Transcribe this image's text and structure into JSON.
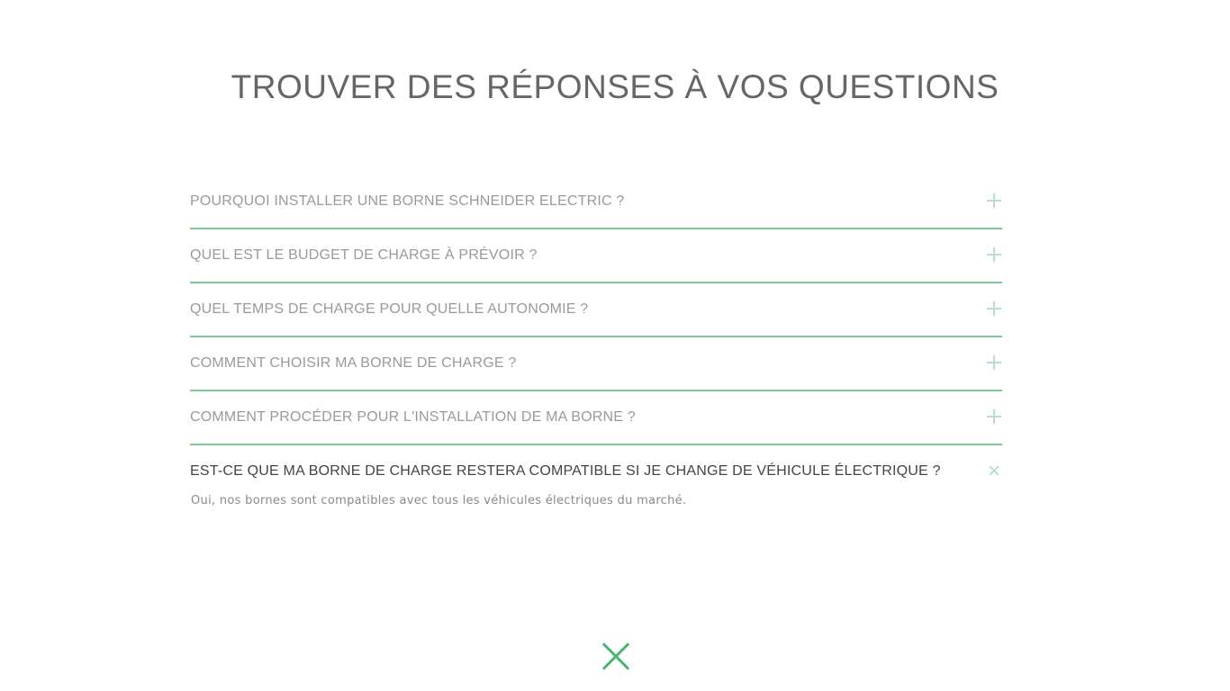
{
  "page": {
    "title": "TROUVER DES RÉPONSES À VOS QUESTIONS"
  },
  "faq": {
    "items": [
      {
        "question": "POURQUOI INSTALLER UNE BORNE SCHNEIDER ELECTRIC ?",
        "state": "collapsed",
        "icon": "plus-icon"
      },
      {
        "question": "QUEL EST LE BUDGET DE CHARGE À PRÉVOIR ?",
        "state": "collapsed",
        "icon": "plus-icon"
      },
      {
        "question": "QUEL TEMPS DE CHARGE POUR QUELLE AUTONOMIE ?",
        "state": "collapsed",
        "icon": "plus-icon"
      },
      {
        "question": "COMMENT CHOISIR MA BORNE DE CHARGE ?",
        "state": "collapsed",
        "icon": "plus-icon"
      },
      {
        "question": "COMMENT PROCÉDER POUR L'INSTALLATION DE MA BORNE ?",
        "state": "collapsed",
        "icon": "plus-icon"
      },
      {
        "question": "EST-CE QUE MA BORNE DE CHARGE RESTERA COMPATIBLE SI JE CHANGE DE VÉHICULE ÉLECTRIQUE ?",
        "state": "expanded",
        "icon": "x-icon",
        "answer": "Oui, nos bornes sont compatibles avec tous les véhicules électriques du marché."
      }
    ]
  },
  "close": {
    "icon": "close-icon"
  },
  "colors": {
    "accent_green": "#4cb573",
    "divider_green": "#7fc99a",
    "icon_light_green": "#b8e0c6",
    "title_gray": "#666666",
    "question_gray": "#9a9a9a",
    "active_question": "#444444",
    "answer_gray": "#8a8a8a"
  }
}
